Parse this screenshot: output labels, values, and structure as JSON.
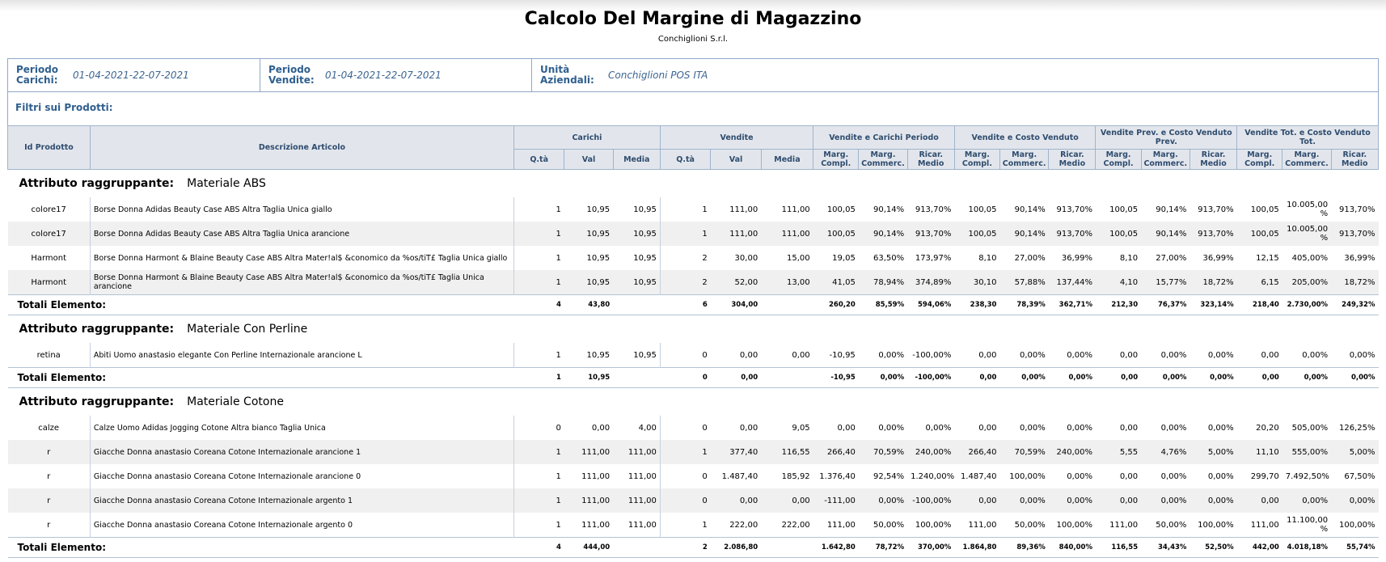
{
  "report": {
    "title": "Calcolo Del Margine di Magazzino",
    "company": "Conchiglioni S.r.l."
  },
  "periods": {
    "carichi_label": "Periodo Carichi:",
    "carichi_value": "01-04-2021-22-07-2021",
    "vendite_label": "Periodo Vendite:",
    "vendite_value": "01-04-2021-22-07-2021",
    "unita_label": "Unità Aziendali:",
    "unita_value": "Conchiglioni POS ITA"
  },
  "filters_label": "Filtri sui Prodotti:",
  "header": {
    "id": "Id Prodotto",
    "desc": "Descrizione Articolo",
    "carichi": "Carichi",
    "vendite": "Vendite",
    "vcp": "Vendite e Carichi Periodo",
    "vcv": "Vendite e Costo Venduto",
    "vpcv": "Vendite Prev. e Costo Venduto Prev.",
    "vtcv": "Vendite Tot. e Costo Venduto Tot.",
    "qta": "Q.tà",
    "val": "Val",
    "media": "Media",
    "marg": "Marg. Compl.",
    "comm": "Marg. Commerc.",
    "ricar": "Ricar. Medio"
  },
  "group_label": "Attributo raggruppante:",
  "total_label": "Totali Elemento:",
  "groups": [
    {
      "name": "Materiale ABS",
      "rows": [
        {
          "id": "colore17",
          "desc": "Borse Donna Adidas Beauty Case ABS Altra Taglia Unica giallo",
          "cq": "1",
          "cv": "10,95",
          "cm": "10,95",
          "vq": "1",
          "vv": "111,00",
          "vm": "111,00",
          "a1": "100,05",
          "a2": "90,14%",
          "a3": "913,70%",
          "b1": "100,05",
          "b2": "90,14%",
          "b3": "913,70%",
          "c1": "100,05",
          "c2": "90,14%",
          "c3": "913,70%",
          "d1": "100,05",
          "d2": "10.005,00 %",
          "d3": "913,70%"
        },
        {
          "id": "colore17",
          "desc": "Borse Donna Adidas Beauty Case ABS Altra Taglia Unica arancione",
          "cq": "1",
          "cv": "10,95",
          "cm": "10,95",
          "vq": "1",
          "vv": "111,00",
          "vm": "111,00",
          "a1": "100,05",
          "a2": "90,14%",
          "a3": "913,70%",
          "b1": "100,05",
          "b2": "90,14%",
          "b3": "913,70%",
          "c1": "100,05",
          "c2": "90,14%",
          "c3": "913,70%",
          "d1": "100,05",
          "d2": "10.005,00 %",
          "d3": "913,70%"
        },
        {
          "id": "Harmont",
          "desc": "Borse Donna Harmont & Blaine Beauty Case ABS Altra Mater!al$ &conomico da %os/tiT£ Taglia Unica giallo",
          "cq": "1",
          "cv": "10,95",
          "cm": "10,95",
          "vq": "2",
          "vv": "30,00",
          "vm": "15,00",
          "a1": "19,05",
          "a2": "63,50%",
          "a3": "173,97%",
          "b1": "8,10",
          "b2": "27,00%",
          "b3": "36,99%",
          "c1": "8,10",
          "c2": "27,00%",
          "c3": "36,99%",
          "d1": "12,15",
          "d2": "405,00%",
          "d3": "36,99%"
        },
        {
          "id": "Harmont",
          "desc": "Borse Donna Harmont & Blaine Beauty Case ABS Altra Mater!al$ &conomico da %os/tiT£ Taglia Unica arancione",
          "cq": "1",
          "cv": "10,95",
          "cm": "10,95",
          "vq": "2",
          "vv": "52,00",
          "vm": "13,00",
          "a1": "41,05",
          "a2": "78,94%",
          "a3": "374,89%",
          "b1": "30,10",
          "b2": "57,88%",
          "b3": "137,44%",
          "c1": "4,10",
          "c2": "15,77%",
          "c3": "18,72%",
          "d1": "6,15",
          "d2": "205,00%",
          "d3": "18,72%"
        }
      ],
      "total": {
        "cq": "4",
        "cv": "43,80",
        "vq": "6",
        "vv": "304,00",
        "a1": "260,20",
        "a2": "85,59%",
        "a3": "594,06%",
        "b1": "238,30",
        "b2": "78,39%",
        "b3": "362,71%",
        "c1": "212,30",
        "c2": "76,37%",
        "c3": "323,14%",
        "d1": "218,40",
        "d2": "2.730,00%",
        "d3": "249,32%"
      }
    },
    {
      "name": "Materiale Con Perline",
      "rows": [
        {
          "id": "retina",
          "desc": "Abiti Uomo anastasio elegante Con Perline Internazionale arancione L",
          "cq": "1",
          "cv": "10,95",
          "cm": "10,95",
          "vq": "0",
          "vv": "0,00",
          "vm": "0,00",
          "a1": "-10,95",
          "a2": "0,00%",
          "a3": "-100,00%",
          "b1": "0,00",
          "b2": "0,00%",
          "b3": "0,00%",
          "c1": "0,00",
          "c2": "0,00%",
          "c3": "0,00%",
          "d1": "0,00",
          "d2": "0,00%",
          "d3": "0,00%"
        }
      ],
      "total": {
        "cq": "1",
        "cv": "10,95",
        "vq": "0",
        "vv": "0,00",
        "a1": "-10,95",
        "a2": "0,00%",
        "a3": "-100,00%",
        "b1": "0,00",
        "b2": "0,00%",
        "b3": "0,00%",
        "c1": "0,00",
        "c2": "0,00%",
        "c3": "0,00%",
        "d1": "0,00",
        "d2": "0,00%",
        "d3": "0,00%"
      }
    },
    {
      "name": "Materiale Cotone",
      "rows": [
        {
          "id": "calze",
          "desc": "Calze Uomo Adidas Jogging Cotone Altra bianco Taglia Unica",
          "cq": "0",
          "cv": "0,00",
          "cm": "4,00",
          "vq": "0",
          "vv": "0,00",
          "vm": "9,05",
          "a1": "0,00",
          "a2": "0,00%",
          "a3": "0,00%",
          "b1": "0,00",
          "b2": "0,00%",
          "b3": "0,00%",
          "c1": "0,00",
          "c2": "0,00%",
          "c3": "0,00%",
          "d1": "20,20",
          "d2": "505,00%",
          "d3": "126,25%"
        },
        {
          "id": "r",
          "desc": "Giacche Donna anastasio Coreana Cotone Internazionale arancione 1",
          "cq": "1",
          "cv": "111,00",
          "cm": "111,00",
          "vq": "1",
          "vv": "377,40",
          "vm": "116,55",
          "a1": "266,40",
          "a2": "70,59%",
          "a3": "240,00%",
          "b1": "266,40",
          "b2": "70,59%",
          "b3": "240,00%",
          "c1": "5,55",
          "c2": "4,76%",
          "c3": "5,00%",
          "d1": "11,10",
          "d2": "555,00%",
          "d3": "5,00%"
        },
        {
          "id": "r",
          "desc": "Giacche Donna anastasio Coreana Cotone Internazionale arancione 0",
          "cq": "1",
          "cv": "111,00",
          "cm": "111,00",
          "vq": "0",
          "vv": "1.487,40",
          "vm": "185,92",
          "a1": "1.376,40",
          "a2": "92,54%",
          "a3": "1.240,00%",
          "b1": "1.487,40",
          "b2": "100,00%",
          "b3": "0,00%",
          "c1": "0,00",
          "c2": "0,00%",
          "c3": "0,00%",
          "d1": "299,70",
          "d2": "7.492,50%",
          "d3": "67,50%"
        },
        {
          "id": "r",
          "desc": "Giacche Donna anastasio Coreana Cotone Internazionale argento 1",
          "cq": "1",
          "cv": "111,00",
          "cm": "111,00",
          "vq": "0",
          "vv": "0,00",
          "vm": "0,00",
          "a1": "-111,00",
          "a2": "0,00%",
          "a3": "-100,00%",
          "b1": "0,00",
          "b2": "0,00%",
          "b3": "0,00%",
          "c1": "0,00",
          "c2": "0,00%",
          "c3": "0,00%",
          "d1": "0,00",
          "d2": "0,00%",
          "d3": "0,00%"
        },
        {
          "id": "r",
          "desc": "Giacche Donna anastasio Coreana Cotone Internazionale argento 0",
          "cq": "1",
          "cv": "111,00",
          "cm": "111,00",
          "vq": "1",
          "vv": "222,00",
          "vm": "222,00",
          "a1": "111,00",
          "a2": "50,00%",
          "a3": "100,00%",
          "b1": "111,00",
          "b2": "50,00%",
          "b3": "100,00%",
          "c1": "111,00",
          "c2": "50,00%",
          "c3": "100,00%",
          "d1": "111,00",
          "d2": "11.100,00 %",
          "d3": "100,00%"
        }
      ],
      "total": {
        "cq": "4",
        "cv": "444,00",
        "vq": "2",
        "vv": "2.086,80",
        "a1": "1.642,80",
        "a2": "78,72%",
        "a3": "370,00%",
        "b1": "1.864,80",
        "b2": "89,36%",
        "b3": "840,00%",
        "c1": "116,55",
        "c2": "34,43%",
        "c3": "52,50%",
        "d1": "442,00",
        "d2": "4.018,18%",
        "d3": "55,74%"
      }
    }
  ]
}
